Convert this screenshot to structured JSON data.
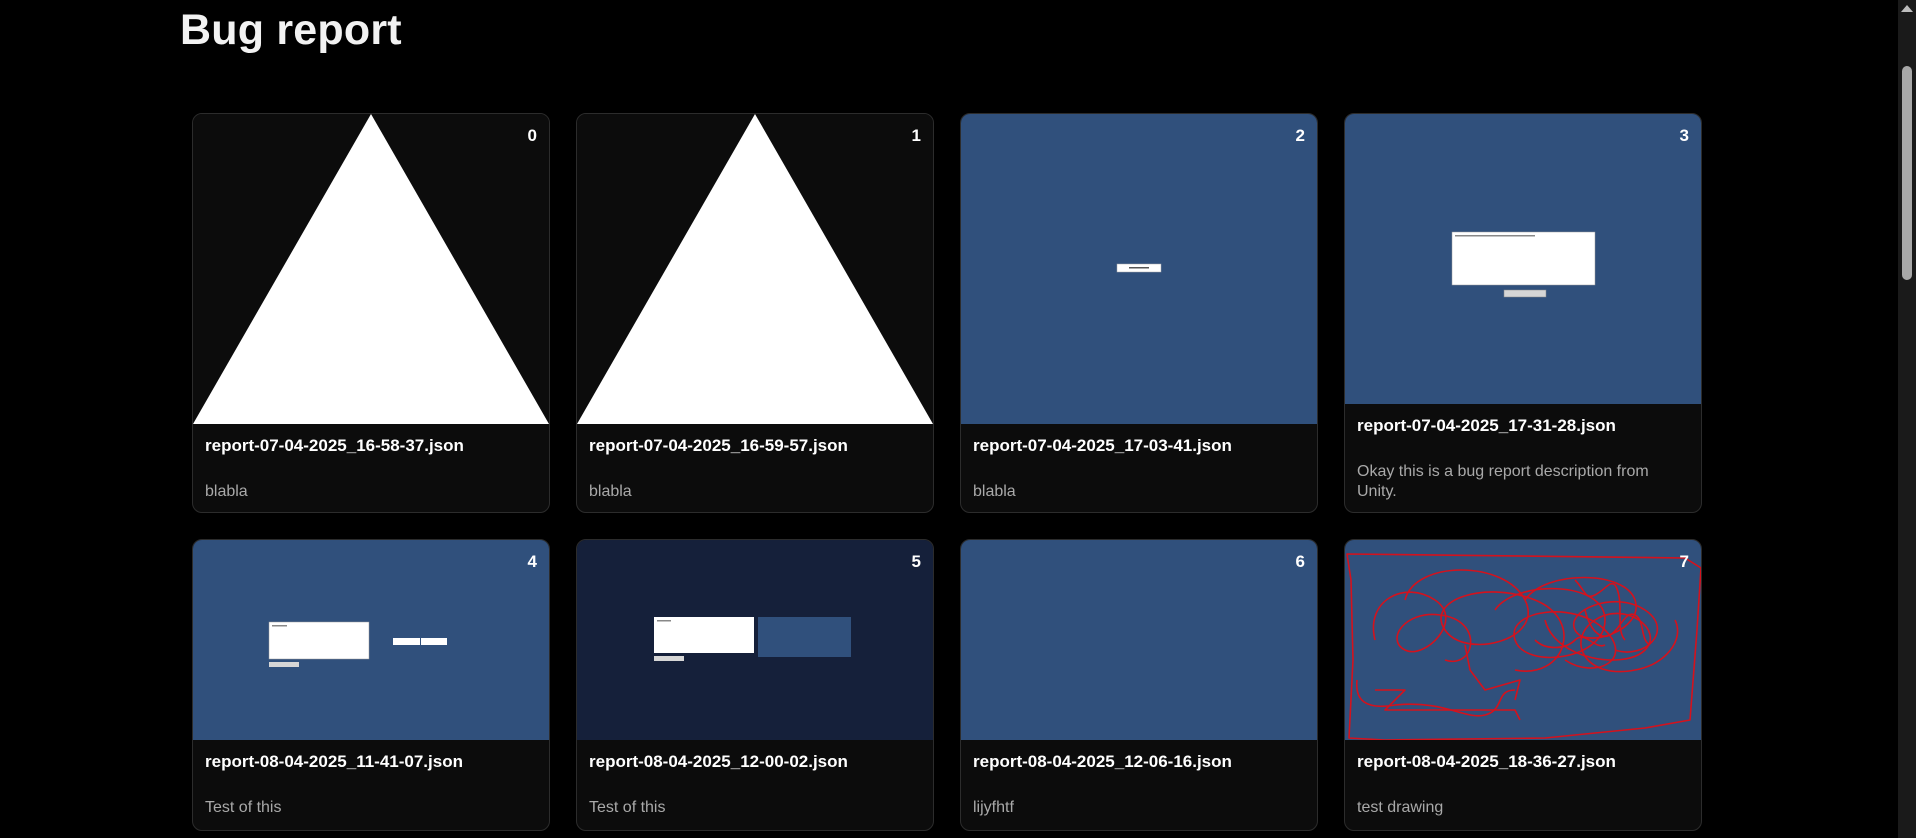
{
  "page": {
    "title": "Bug report"
  },
  "reports": [
    {
      "index": "0",
      "filename": "report-07-04-2025_16-58-37.json",
      "description": "blabla",
      "thumbnail": "white-triangle"
    },
    {
      "index": "1",
      "filename": "report-07-04-2025_16-59-57.json",
      "description": "blabla",
      "thumbnail": "white-triangle"
    },
    {
      "index": "2",
      "filename": "report-07-04-2025_17-03-41.json",
      "description": "blabla",
      "thumbnail": "blue-screen-button"
    },
    {
      "index": "3",
      "filename": "report-07-04-2025_17-31-28.json",
      "description": "Okay this is a bug report description from Unity.",
      "thumbnail": "blue-screen-form"
    },
    {
      "index": "4",
      "filename": "report-08-04-2025_11-41-07.json",
      "description": "Test of this",
      "thumbnail": "blue-screen-form-inputs"
    },
    {
      "index": "5",
      "filename": "report-08-04-2025_12-00-02.json",
      "description": "Test of this",
      "thumbnail": "dark-screen-form-panel"
    },
    {
      "index": "6",
      "filename": "report-08-04-2025_12-06-16.json",
      "description": "lijyfhtf",
      "thumbnail": "blue-screen-empty"
    },
    {
      "index": "7",
      "filename": "report-08-04-2025_18-36-27.json",
      "description": "test drawing",
      "thumbnail": "blue-screen-red-scribble"
    }
  ],
  "colors": {
    "background": "#000000",
    "card": "#0c0c0c",
    "unity_blue": "#30507c",
    "unity_dark": "#15203a",
    "scribble": "#d4121d"
  },
  "icons": {
    "scroll_up": "triangle-up-icon"
  }
}
